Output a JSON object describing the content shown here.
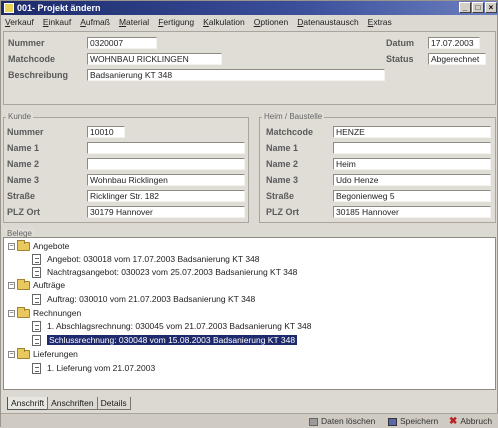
{
  "window": {
    "title": "001- Projekt ändern"
  },
  "menu": [
    "Verkauf",
    "Einkauf",
    "Aufmaß",
    "Material",
    "Fertigung",
    "Kalkulation",
    "Optionen",
    "Datenaustausch",
    "Extras"
  ],
  "project": {
    "nummer_label": "Nummer",
    "nummer": "0320007",
    "matchcode_label": "Matchcode",
    "matchcode": "WOHNBAU RICKLINGEN",
    "beschreibung_label": "Beschreibung",
    "beschreibung": "Badsanierung KT 348",
    "datum_label": "Datum",
    "datum": "17.07.2003",
    "status_label": "Status",
    "status": "Abgerechnet"
  },
  "kunde": {
    "title": "Kunde",
    "nummer_label": "Nummer",
    "nummer": "10010",
    "name1_label": "Name 1",
    "name1": "",
    "name2_label": "Name 2",
    "name2": "",
    "name3_label": "Name 3",
    "name3": "Wohnbau Ricklingen",
    "strasse_label": "Straße",
    "strasse": "Ricklinger Str. 182",
    "plzort_label": "PLZ Ort",
    "plzort": "30179 Hannover"
  },
  "baustelle": {
    "title": "Heim / Baustelle",
    "matchcode_label": "Matchcode",
    "matchcode": "HENZE",
    "name1_label": "Name 1",
    "name1": "",
    "name2_label": "Name 2",
    "name2": "Heim",
    "name3_label": "Name 3",
    "name3": "Udo Henze",
    "strasse_label": "Straße",
    "strasse": "Begonienweg 5",
    "plzort_label": "PLZ Ort",
    "plzort": "30185 Hannover"
  },
  "belege": {
    "title": "Belege",
    "groups": [
      {
        "label": "Angebote",
        "items": [
          "Angebot: 030018 vom 17.07.2003 Badsanierung KT 348",
          "Nachtragsangebot: 030023 vom 25.07.2003 Badsanierung KT 348"
        ]
      },
      {
        "label": "Aufträge",
        "items": [
          "Auftrag: 030010 vom 21.07.2003 Badsanierung KT 348"
        ]
      },
      {
        "label": "Rechnungen",
        "items": [
          "1. Abschlagsrechnung: 030045 vom 21.07.2003 Badsanierung KT 348",
          "Schlussrechnung: 030048 vom 15.08.2003 Badsanierung KT 348"
        ]
      },
      {
        "label": "Lieferungen",
        "items": [
          "1. Lieferung vom 21.07.2003"
        ]
      }
    ]
  },
  "tabs": [
    "Anschrift",
    "Anschriften",
    "Details"
  ],
  "actions": {
    "reset": "Daten löschen",
    "save": "Speichern",
    "cancel": "Abbruch"
  }
}
